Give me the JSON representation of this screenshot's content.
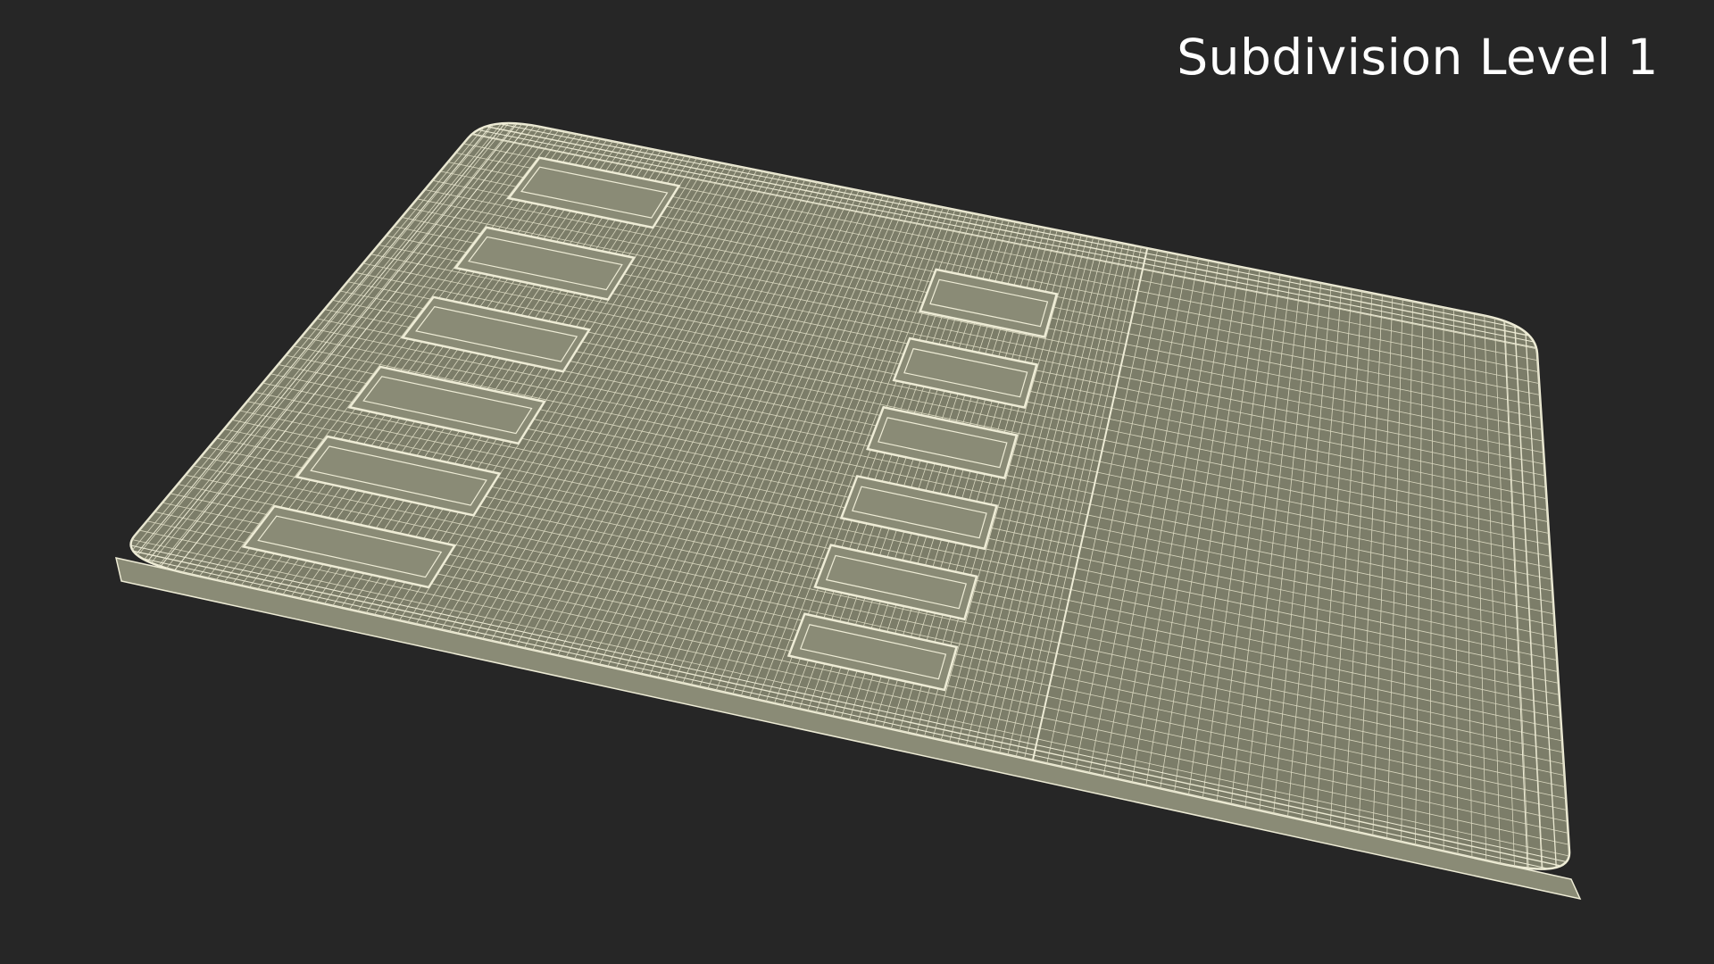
{
  "viewport": {
    "label": "Subdivision Level 1"
  },
  "colors": {
    "background": "#262626",
    "label_text": "#ffffff",
    "mesh_fill": "#7c7d69",
    "mesh_fill_light": "#8a8b76",
    "wire": "#eeecd6",
    "wire_faint": "#d9d7bf"
  },
  "model": {
    "name": "wireframe-slab-with-rectangular-recesses",
    "left_recess_count": 6,
    "middle_recess_count": 6
  }
}
